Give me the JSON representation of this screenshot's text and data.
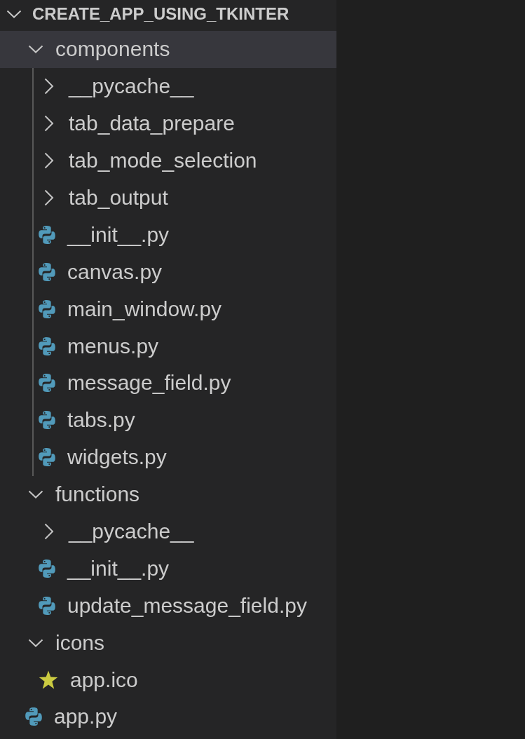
{
  "explorer": {
    "title": "CREATE_APP_USING_TKINTER",
    "expanded": true,
    "children": [
      {
        "kind": "folder",
        "name": "components",
        "expanded": true,
        "selected": true,
        "children": [
          {
            "kind": "folder",
            "name": "__pycache__",
            "expanded": false,
            "selected": false
          },
          {
            "kind": "folder",
            "name": "tab_data_prepare",
            "expanded": false,
            "selected": false
          },
          {
            "kind": "folder",
            "name": "tab_mode_selection",
            "expanded": false,
            "selected": false
          },
          {
            "kind": "folder",
            "name": "tab_output",
            "expanded": false,
            "selected": false
          },
          {
            "kind": "python",
            "name": "__init__.py",
            "selected": false
          },
          {
            "kind": "python",
            "name": "canvas.py",
            "selected": false
          },
          {
            "kind": "python",
            "name": "main_window.py",
            "selected": false
          },
          {
            "kind": "python",
            "name": "menus.py",
            "selected": false
          },
          {
            "kind": "python",
            "name": "message_field.py",
            "selected": false
          },
          {
            "kind": "python",
            "name": "tabs.py",
            "selected": false
          },
          {
            "kind": "python",
            "name": "widgets.py",
            "selected": false
          }
        ]
      },
      {
        "kind": "folder",
        "name": "functions",
        "expanded": true,
        "selected": false,
        "children": [
          {
            "kind": "folder",
            "name": "__pycache__",
            "expanded": false,
            "selected": false
          },
          {
            "kind": "python",
            "name": "__init__.py",
            "selected": false
          },
          {
            "kind": "python",
            "name": "update_message_field.py",
            "selected": false
          }
        ]
      },
      {
        "kind": "folder",
        "name": "icons",
        "expanded": true,
        "selected": false,
        "children": [
          {
            "kind": "ico",
            "name": "app.ico",
            "selected": false
          }
        ]
      },
      {
        "kind": "python",
        "name": "app.py",
        "selected": false
      }
    ]
  }
}
